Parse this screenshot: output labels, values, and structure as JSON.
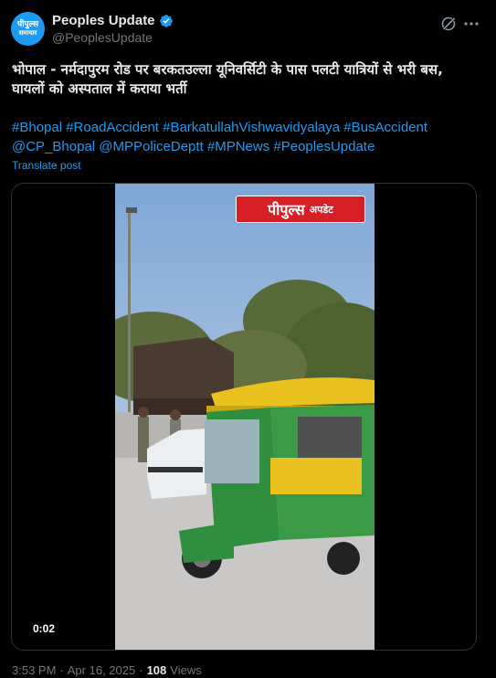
{
  "account": {
    "display_name": "Peoples Update",
    "handle": "@PeoplesUpdate",
    "avatar_line1": "पीपुल्स",
    "avatar_line2": "समाचार"
  },
  "icons": {
    "verified": "verified-badge-icon",
    "grok": "grok-icon",
    "more": "more-icon"
  },
  "post": {
    "text": "भोपाल - नर्मदापुरम रोड पर बरकतउल्ला यूनिवर्सिटी के पास पलटी यात्रियों से भरी बस, घायलों को अस्पताल में कराया भर्ती",
    "hashtags_line1": "#Bhopal #RoadAccident #BarkatullahVishwavidyalaya #BusAccident",
    "hashtags_line2": "@CP_Bhopal @MPPoliceDeptt #MPNews #PeoplesUpdate",
    "translate_label": "Translate post"
  },
  "media": {
    "duration": "0:02",
    "brand_badge_part1": "पीपुल्स",
    "brand_badge_part2": "अपडेट"
  },
  "footer": {
    "time": "3:53 PM",
    "separator": "·",
    "date": "Apr 16, 2025",
    "views_count": "108",
    "views_label": "Views"
  },
  "colors": {
    "accent": "#1d9bf0",
    "background": "#000000",
    "text": "#e7e9ea",
    "muted": "#71767b",
    "badge_red": "#d61f26"
  }
}
